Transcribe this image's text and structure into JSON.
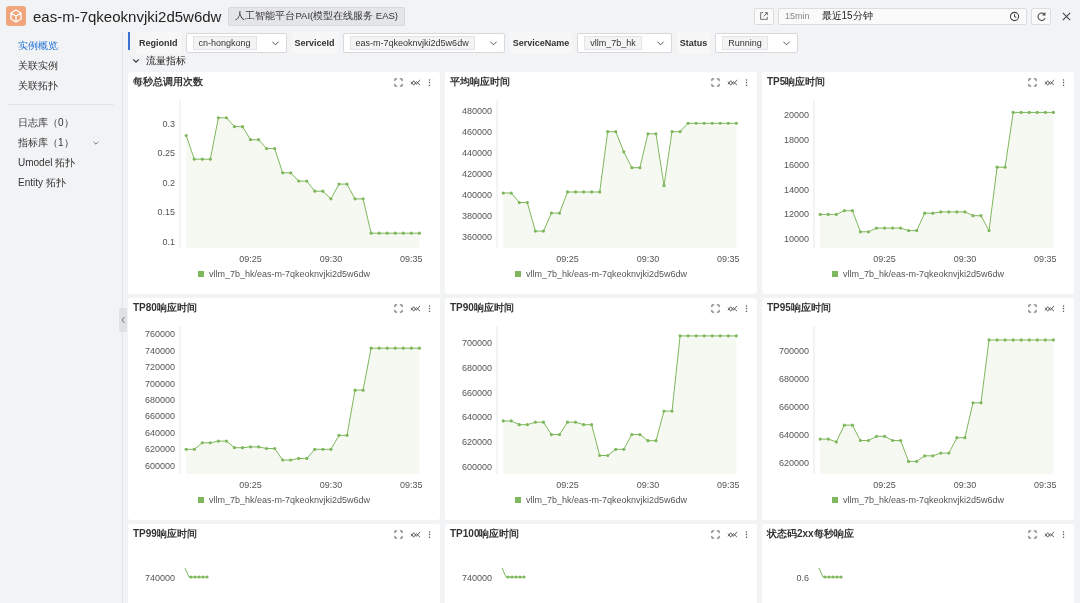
{
  "header": {
    "title": "eas-m-7qkeoknvjki2d5w6dw",
    "badge": "人工智能平台PAI(模型在线服务 EAS)",
    "time_short": "15min",
    "time_range": "最近15分钟"
  },
  "sidebar": {
    "sections": [
      {
        "items": [
          {
            "label": "实例概览",
            "selected": true,
            "kind": "link"
          },
          {
            "label": "关联实例",
            "selected": false,
            "kind": "link"
          },
          {
            "label": "关联拓扑",
            "selected": false,
            "kind": "link"
          }
        ]
      },
      {
        "items": [
          {
            "label": "日志库（0）",
            "selected": false,
            "kind": "link"
          },
          {
            "label": "指标库（1）",
            "selected": false,
            "kind": "group"
          },
          {
            "label": "Umodel 拓扑",
            "selected": false,
            "kind": "link"
          },
          {
            "label": "Entity 拓扑",
            "selected": false,
            "kind": "link"
          }
        ]
      }
    ]
  },
  "filters": [
    {
      "label": "RegionId",
      "value": "cn-hongkong"
    },
    {
      "label": "ServiceId",
      "value": "eas-m-7qkeoknvjki2d5w6dw"
    },
    {
      "label": "ServiceName",
      "value": "vllm_7b_hk"
    },
    {
      "label": "Status",
      "value": "Running"
    }
  ],
  "section": {
    "title": "流量指标",
    "expanded": true
  },
  "panels": [
    {
      "kind": "chart",
      "title": "每秒总调用次数",
      "chart_data": {
        "type": "area",
        "categories": [
          null,
          null,
          null,
          null,
          null,
          null,
          null,
          null,
          "09:25",
          null,
          null,
          null,
          null,
          null,
          null,
          null,
          null,
          null,
          "09:30",
          null,
          null,
          null,
          null,
          null,
          null,
          null,
          null,
          null,
          "09:35",
          null
        ],
        "ylim": [
          0.09,
          0.34
        ],
        "yticks": [
          0.1,
          0.15,
          0.2,
          0.25,
          0.3
        ],
        "series": [
          {
            "name": "vllm_7b_hk/eas-m-7qkeoknvjki2d5w6dw",
            "color": "#7fb75c",
            "values": [
              0.28,
              0.24,
              0.24,
              0.24,
              0.31,
              0.31,
              0.295,
              0.295,
              0.273,
              0.273,
              0.258,
              0.258,
              0.217,
              0.217,
              0.203,
              0.203,
              0.186,
              0.186,
              0.173,
              0.198,
              0.198,
              0.173,
              0.173,
              0.115,
              0.115,
              0.115,
              0.115,
              0.115,
              0.115,
              0.115
            ]
          }
        ]
      }
    },
    {
      "kind": "chart",
      "title": "平均响应时间",
      "chart_data": {
        "type": "area",
        "categories": [
          null,
          null,
          null,
          null,
          null,
          null,
          null,
          null,
          "09:25",
          null,
          null,
          null,
          null,
          null,
          null,
          null,
          null,
          null,
          "09:30",
          null,
          null,
          null,
          null,
          null,
          null,
          null,
          null,
          null,
          "09:35",
          null
        ],
        "ylim": [
          350000,
          490000
        ],
        "yticks": [
          360000,
          380000,
          400000,
          420000,
          440000,
          460000,
          480000
        ],
        "series": [
          {
            "name": "vllm_7b_hk/eas-m-7qkeoknvjki2d5w6dw",
            "color": "#7fb75c",
            "values": [
              402000,
              402000,
              393000,
              393000,
              366000,
              366000,
              383000,
              383000,
              403000,
              403000,
              403000,
              403000,
              403000,
              460000,
              460000,
              441000,
              426000,
              426000,
              458000,
              458000,
              409000,
              460000,
              460000,
              468000,
              468000,
              468000,
              468000,
              468000,
              468000,
              468000
            ]
          }
        ]
      }
    },
    {
      "kind": "chart",
      "title": "TP5响应时间",
      "chart_data": {
        "type": "area",
        "categories": [
          null,
          null,
          null,
          null,
          null,
          null,
          null,
          null,
          "09:25",
          null,
          null,
          null,
          null,
          null,
          null,
          null,
          null,
          null,
          "09:30",
          null,
          null,
          null,
          null,
          null,
          null,
          null,
          null,
          null,
          "09:35",
          null
        ],
        "ylim": [
          9300,
          21200
        ],
        "yticks": [
          10000,
          12000,
          14000,
          16000,
          18000,
          20000
        ],
        "series": [
          {
            "name": "vllm_7b_hk/eas-m-7qkeoknvjki2d5w6dw",
            "color": "#7fb75c",
            "values": [
              12000,
              12000,
              12000,
              12300,
              12300,
              10600,
              10600,
              10900,
              10900,
              10900,
              10900,
              10700,
              10700,
              12100,
              12100,
              12200,
              12200,
              12200,
              12200,
              11900,
              11900,
              10700,
              15800,
              15800,
              20200,
              20200,
              20200,
              20200,
              20200,
              20200
            ]
          }
        ]
      }
    },
    {
      "kind": "chart",
      "title": "TP80响应时间",
      "chart_data": {
        "type": "area",
        "categories": [
          null,
          null,
          null,
          null,
          null,
          null,
          null,
          null,
          "09:25",
          null,
          null,
          null,
          null,
          null,
          null,
          null,
          null,
          null,
          "09:30",
          null,
          null,
          null,
          null,
          null,
          null,
          null,
          null,
          null,
          "09:35",
          null
        ],
        "ylim": [
          590000,
          770000
        ],
        "yticks": [
          600000,
          620000,
          640000,
          660000,
          680000,
          700000,
          720000,
          740000,
          760000
        ],
        "series": [
          {
            "name": "vllm_7b_hk/eas-m-7qkeoknvjki2d5w6dw",
            "color": "#7fb75c",
            "values": [
              620000,
              620000,
              628000,
              628000,
              630000,
              630000,
              622000,
              622000,
              623000,
              623000,
              621000,
              621000,
              607000,
              607000,
              609000,
              609000,
              620000,
              620000,
              620000,
              637000,
              637000,
              692000,
              692000,
              743000,
              743000,
              743000,
              743000,
              743000,
              743000,
              743000
            ]
          }
        ]
      }
    },
    {
      "kind": "chart",
      "title": "TP90响应时间",
      "chart_data": {
        "type": "area",
        "categories": [
          null,
          null,
          null,
          null,
          null,
          null,
          null,
          null,
          "09:25",
          null,
          null,
          null,
          null,
          null,
          null,
          null,
          null,
          null,
          "09:30",
          null,
          null,
          null,
          null,
          null,
          null,
          null,
          null,
          null,
          "09:35",
          null
        ],
        "ylim": [
          594000,
          714000
        ],
        "yticks": [
          600000,
          620000,
          640000,
          660000,
          680000,
          700000
        ],
        "series": [
          {
            "name": "vllm_7b_hk/eas-m-7qkeoknvjki2d5w6dw",
            "color": "#7fb75c",
            "values": [
              637000,
              637000,
              634000,
              634000,
              636000,
              636000,
              626000,
              626000,
              636000,
              636000,
              634000,
              634000,
              609000,
              609000,
              614000,
              614000,
              626000,
              626000,
              621000,
              621000,
              645000,
              645000,
              706000,
              706000,
              706000,
              706000,
              706000,
              706000,
              706000,
              706000
            ]
          }
        ]
      }
    },
    {
      "kind": "chart",
      "title": "TP95响应时间",
      "chart_data": {
        "type": "area",
        "categories": [
          null,
          null,
          null,
          null,
          null,
          null,
          null,
          null,
          "09:25",
          null,
          null,
          null,
          null,
          null,
          null,
          null,
          null,
          null,
          "09:30",
          null,
          null,
          null,
          null,
          null,
          null,
          null,
          null,
          null,
          "09:35",
          null
        ],
        "ylim": [
          612000,
          718000
        ],
        "yticks": [
          620000,
          640000,
          660000,
          680000,
          700000
        ],
        "series": [
          {
            "name": "vllm_7b_hk/eas-m-7qkeoknvjki2d5w6dw",
            "color": "#7fb75c",
            "values": [
              637000,
              637000,
              635000,
              647000,
              647000,
              636000,
              636000,
              639000,
              639000,
              636000,
              636000,
              621000,
              621000,
              625000,
              625000,
              627000,
              627000,
              638000,
              638000,
              663000,
              663000,
              708000,
              708000,
              708000,
              708000,
              708000,
              708000,
              708000,
              708000,
              708000
            ]
          }
        ]
      }
    },
    {
      "kind": "partial",
      "title": "TP99响应时间",
      "tick": "740000"
    },
    {
      "kind": "partial",
      "title": "TP100响应时间",
      "tick": "740000"
    },
    {
      "kind": "partial",
      "title": "状态码2xx每秒响应",
      "tick": "0.6"
    }
  ]
}
